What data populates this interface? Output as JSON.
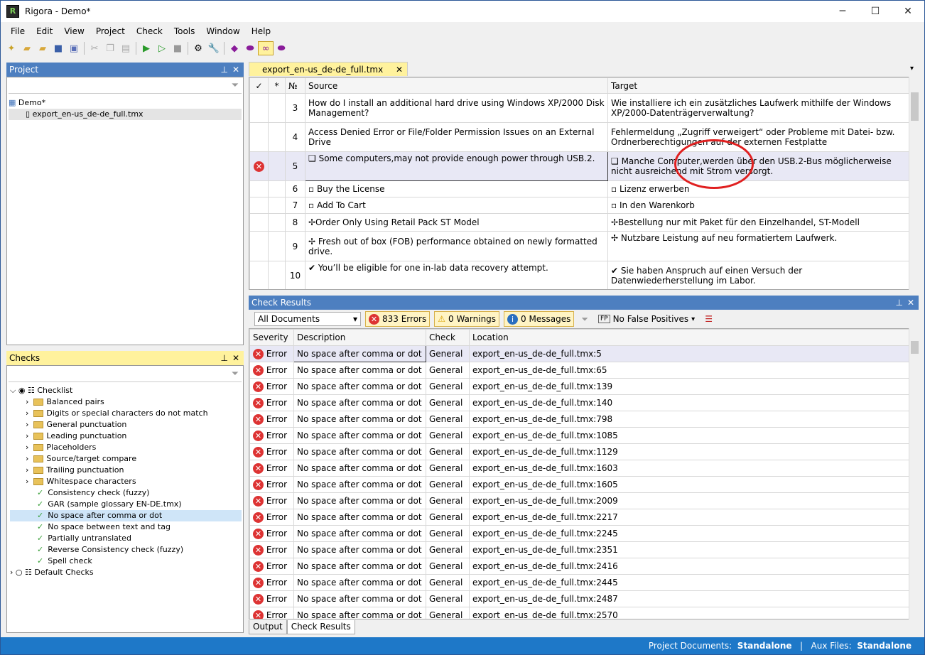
{
  "window": {
    "title": "Rigora - Demo*",
    "minimize": "─",
    "maximize": "☐",
    "close": "✕"
  },
  "menu": [
    {
      "label": "File"
    },
    {
      "label": "Edit"
    },
    {
      "label": "View"
    },
    {
      "label": "Project"
    },
    {
      "label": "Check"
    },
    {
      "label": "Tools"
    },
    {
      "label": "Window"
    },
    {
      "label": "Help"
    }
  ],
  "project_panel": {
    "title": "Project",
    "pin": "⊥",
    "close": "✕",
    "root": "Demo*",
    "file": "export_en-us_de-de_full.tmx"
  },
  "checks_panel": {
    "title": "Checks",
    "pin": "⊥",
    "close": "✕",
    "root1": "Checklist",
    "folders": [
      "Balanced pairs",
      "Digits or special characters do not match",
      "General punctuation",
      "Leading punctuation",
      "Placeholders",
      "Source/target compare",
      "Trailing punctuation",
      "Whitespace characters"
    ],
    "checks": [
      "Consistency check (fuzzy)",
      "GAR (sample glossary EN-DE.tmx)",
      "No space after comma or dot",
      "No space between text and tag",
      "Partially untranslated",
      "Reverse Consistency check (fuzzy)",
      "Spell check"
    ],
    "root2": "Default Checks"
  },
  "doc_tab": {
    "label": "export_en-us_de-de_full.tmx",
    "close": "✕"
  },
  "segments": {
    "headers": {
      "check": "✓",
      "star": "*",
      "num": "№",
      "source": "Source",
      "target": "Target"
    },
    "rows": [
      {
        "num": "3",
        "source": "How do I install an additional hard drive using Windows XP/2000 Disk Management?",
        "target": "Wie installiere ich ein zusätzliches Laufwerk mithilfe der Windows XP/2000-Datenträgerverwaltung?",
        "err": false
      },
      {
        "num": "4",
        "source": "Access Denied Error or File/Folder Permission Issues on an External Drive",
        "target": "Fehlermeldung „Zugriff verweigert“ oder Probleme mit Datei- bzw. Ordnerberechtigungen auf der externen Festplatte",
        "err": false
      },
      {
        "num": "5",
        "source": "❑ Some computers,may not provide enough power through USB.2.",
        "target": "❑ Manche Computer,werden über den USB.2-Bus möglicherweise nicht ausreichend mit Strom versorgt.",
        "err": true
      },
      {
        "num": "6",
        "source": "▫ Buy the License",
        "target": "▫ Lizenz erwerben",
        "err": false
      },
      {
        "num": "7",
        "source": "▫ Add To Cart",
        "target": "▫ In den Warenkorb",
        "err": false
      },
      {
        "num": "8",
        "source": "✢Order Only Using Retail Pack ST Model",
        "target": "✢Bestellung nur mit Paket für den Einzelhandel, ST-Modell",
        "err": false
      },
      {
        "num": "9",
        "source": "✢ Fresh out of box (FOB) performance obtained on newly formatted drive.",
        "target": "✢ Nutzbare Leistung auf neu formatiertem Laufwerk.",
        "err": false
      },
      {
        "num": "10",
        "source": "✔ You’ll be eligible for one in-lab data recovery attempt.",
        "target": "✔ Sie haben Anspruch auf einen Versuch der Datenwiederherstellung im Labor.",
        "err": false
      }
    ]
  },
  "results_panel": {
    "title": "Check Results",
    "pin": "⊥",
    "close": "✕",
    "scope": "All Documents",
    "errors": "833 Errors",
    "warnings": "0 Warnings",
    "messages": "0 Messages",
    "false_pos": "No False Positives",
    "fp_tag": "FP"
  },
  "results": {
    "headers": {
      "severity": "Severity",
      "description": "Description",
      "check": "Check",
      "location": "Location"
    },
    "rows": [
      {
        "sev": "Error",
        "desc": "No space after comma or dot",
        "check": "General",
        "loc": "export_en-us_de-de_full.tmx:5"
      },
      {
        "sev": "Error",
        "desc": "No space after comma or dot",
        "check": "General",
        "loc": "export_en-us_de-de_full.tmx:65"
      },
      {
        "sev": "Error",
        "desc": "No space after comma or dot",
        "check": "General",
        "loc": "export_en-us_de-de_full.tmx:139"
      },
      {
        "sev": "Error",
        "desc": "No space after comma or dot",
        "check": "General",
        "loc": "export_en-us_de-de_full.tmx:140"
      },
      {
        "sev": "Error",
        "desc": "No space after comma or dot",
        "check": "General",
        "loc": "export_en-us_de-de_full.tmx:798"
      },
      {
        "sev": "Error",
        "desc": "No space after comma or dot",
        "check": "General",
        "loc": "export_en-us_de-de_full.tmx:1085"
      },
      {
        "sev": "Error",
        "desc": "No space after comma or dot",
        "check": "General",
        "loc": "export_en-us_de-de_full.tmx:1129"
      },
      {
        "sev": "Error",
        "desc": "No space after comma or dot",
        "check": "General",
        "loc": "export_en-us_de-de_full.tmx:1603"
      },
      {
        "sev": "Error",
        "desc": "No space after comma or dot",
        "check": "General",
        "loc": "export_en-us_de-de_full.tmx:1605"
      },
      {
        "sev": "Error",
        "desc": "No space after comma or dot",
        "check": "General",
        "loc": "export_en-us_de-de_full.tmx:2009"
      },
      {
        "sev": "Error",
        "desc": "No space after comma or dot",
        "check": "General",
        "loc": "export_en-us_de-de_full.tmx:2217"
      },
      {
        "sev": "Error",
        "desc": "No space after comma or dot",
        "check": "General",
        "loc": "export_en-us_de-de_full.tmx:2245"
      },
      {
        "sev": "Error",
        "desc": "No space after comma or dot",
        "check": "General",
        "loc": "export_en-us_de-de_full.tmx:2351"
      },
      {
        "sev": "Error",
        "desc": "No space after comma or dot",
        "check": "General",
        "loc": "export_en-us_de-de_full.tmx:2416"
      },
      {
        "sev": "Error",
        "desc": "No space after comma or dot",
        "check": "General",
        "loc": "export_en-us_de-de_full.tmx:2445"
      },
      {
        "sev": "Error",
        "desc": "No space after comma or dot",
        "check": "General",
        "loc": "export_en-us_de-de_full.tmx:2487"
      },
      {
        "sev": "Error",
        "desc": "No space after comma or dot",
        "check": "General",
        "loc": "export_en-us_de-de_full.tmx:2570"
      }
    ]
  },
  "bottom_tabs": [
    {
      "label": "Output"
    },
    {
      "label": "Check Results"
    }
  ],
  "status": {
    "docs_label": "Project Documents:",
    "docs_value": "Standalone",
    "sep": "|",
    "aux_label": "Aux Files:",
    "aux_value": "Standalone"
  },
  "colors": {
    "accent": "#4d7fc0",
    "active_tab": "#fff29d",
    "status": "#1e78c8",
    "error": "#d33333"
  }
}
